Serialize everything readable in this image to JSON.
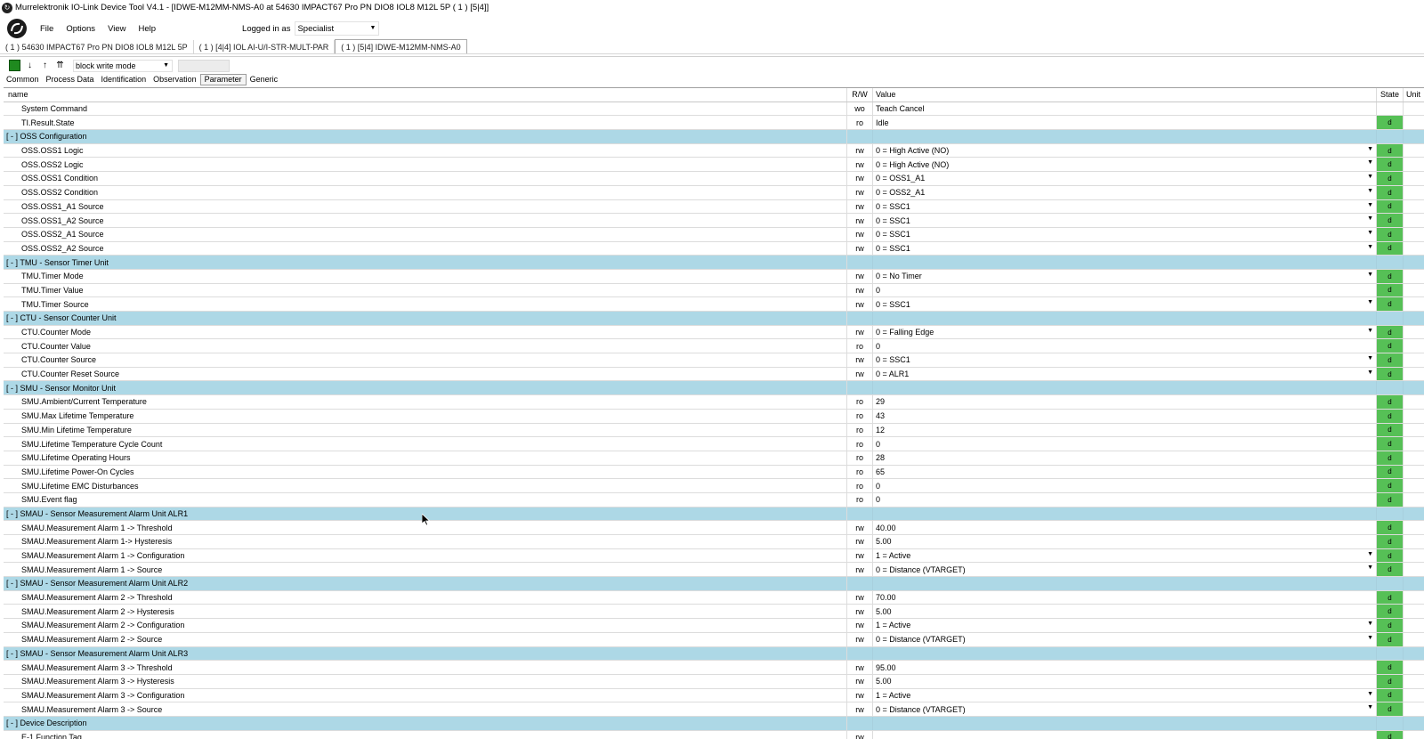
{
  "window": {
    "title": "Murrelektronik IO-Link Device Tool V4.1 - [IDWE-M12MM-NMS-A0 at 54630 IMPACT67 Pro PN DIO8 IOL8 M12L 5P ( 1 ) [5|4]]"
  },
  "menu": {
    "file": "File",
    "options": "Options",
    "view": "View",
    "help": "Help"
  },
  "login": {
    "label": "Logged in as",
    "role": "Specialist"
  },
  "device_tabs": [
    {
      "label": "( 1 ) 54630 IMPACT67 Pro PN DIO8 IOL8 M12L 5P"
    },
    {
      "label": "( 1 ) [4|4] IOL AI-U/I-STR-MULT-PAR"
    },
    {
      "label": "( 1 ) [5|4] IDWE-M12MM-NMS-A0"
    }
  ],
  "toolbar": {
    "mode": "block write mode"
  },
  "view_tabs": [
    {
      "label": "Common"
    },
    {
      "label": "Process Data"
    },
    {
      "label": "Identification"
    },
    {
      "label": "Observation"
    },
    {
      "label": "Parameter"
    },
    {
      "label": "Generic"
    }
  ],
  "columns": {
    "name": "name",
    "rw": "R/W",
    "value": "Value",
    "state": "State",
    "unit": "Unit"
  },
  "rows": [
    {
      "type": "item",
      "name": "System Command",
      "rw": "wo",
      "value": "Teach Cancel",
      "state": "",
      "dd": false
    },
    {
      "type": "item",
      "name": "TI.Result.State",
      "rw": "ro",
      "value": "Idle",
      "state": "d",
      "dd": false
    },
    {
      "type": "group",
      "name": "[ - ]  OSS Configuration"
    },
    {
      "type": "item",
      "name": "OSS.OSS1 Logic",
      "rw": "rw",
      "value": "0 = High Active (NO)",
      "state": "d",
      "dd": true
    },
    {
      "type": "item",
      "name": "OSS.OSS2 Logic",
      "rw": "rw",
      "value": "0 = High Active (NO)",
      "state": "d",
      "dd": true
    },
    {
      "type": "item",
      "name": "OSS.OSS1 Condition",
      "rw": "rw",
      "value": "0 = OSS1_A1",
      "state": "d",
      "dd": true
    },
    {
      "type": "item",
      "name": "OSS.OSS2 Condition",
      "rw": "rw",
      "value": "0 = OSS2_A1",
      "state": "d",
      "dd": true
    },
    {
      "type": "item",
      "name": "OSS.OSS1_A1 Source",
      "rw": "rw",
      "value": "0 = SSC1",
      "state": "d",
      "dd": true
    },
    {
      "type": "item",
      "name": "OSS.OSS1_A2 Source",
      "rw": "rw",
      "value": "0 = SSC1",
      "state": "d",
      "dd": true
    },
    {
      "type": "item",
      "name": "OSS.OSS2_A1 Source",
      "rw": "rw",
      "value": "0 = SSC1",
      "state": "d",
      "dd": true
    },
    {
      "type": "item",
      "name": "OSS.OSS2_A2 Source",
      "rw": "rw",
      "value": "0 = SSC1",
      "state": "d",
      "dd": true
    },
    {
      "type": "group",
      "name": "[ - ]  TMU - Sensor Timer Unit"
    },
    {
      "type": "item",
      "name": "TMU.Timer Mode",
      "rw": "rw",
      "value": "0 = No Timer",
      "state": "d",
      "dd": true
    },
    {
      "type": "item",
      "name": "TMU.Timer Value",
      "rw": "rw",
      "value": "0",
      "state": "d",
      "dd": false
    },
    {
      "type": "item",
      "name": "TMU.Timer Source",
      "rw": "rw",
      "value": "0 = SSC1",
      "state": "d",
      "dd": true
    },
    {
      "type": "group",
      "name": "[ - ]  CTU - Sensor Counter Unit"
    },
    {
      "type": "item",
      "name": "CTU.Counter Mode",
      "rw": "rw",
      "value": "0 = Falling Edge",
      "state": "d",
      "dd": true
    },
    {
      "type": "item",
      "name": "CTU.Counter Value",
      "rw": "ro",
      "value": "0",
      "state": "d",
      "dd": false
    },
    {
      "type": "item",
      "name": "CTU.Counter Source",
      "rw": "rw",
      "value": "0 = SSC1",
      "state": "d",
      "dd": true
    },
    {
      "type": "item",
      "name": "CTU.Counter Reset Source",
      "rw": "rw",
      "value": "0 = ALR1",
      "state": "d",
      "dd": true
    },
    {
      "type": "group",
      "name": "[ - ]  SMU - Sensor Monitor Unit"
    },
    {
      "type": "item",
      "name": "SMU.Ambient/Current Temperature",
      "rw": "ro",
      "value": "29",
      "state": "d",
      "dd": false
    },
    {
      "type": "item",
      "name": "SMU.Max Lifetime Temperature",
      "rw": "ro",
      "value": "43",
      "state": "d",
      "dd": false
    },
    {
      "type": "item",
      "name": "SMU.Min Lifetime Temperature",
      "rw": "ro",
      "value": "12",
      "state": "d",
      "dd": false
    },
    {
      "type": "item",
      "name": "SMU.Lifetime Temperature Cycle Count",
      "rw": "ro",
      "value": "0",
      "state": "d",
      "dd": false
    },
    {
      "type": "item",
      "name": "SMU.Lifetime Operating Hours",
      "rw": "ro",
      "value": "28",
      "state": "d",
      "dd": false
    },
    {
      "type": "item",
      "name": "SMU.Lifetime Power-On Cycles",
      "rw": "ro",
      "value": "65",
      "state": "d",
      "dd": false
    },
    {
      "type": "item",
      "name": "SMU.Lifetime EMC Disturbances",
      "rw": "ro",
      "value": "0",
      "state": "d",
      "dd": false
    },
    {
      "type": "item",
      "name": "SMU.Event flag",
      "rw": "ro",
      "value": "0",
      "state": "d",
      "dd": false
    },
    {
      "type": "group",
      "name": "[ - ]  SMAU - Sensor Measurement Alarm Unit ALR1"
    },
    {
      "type": "item",
      "name": "SMAU.Measurement Alarm 1 -> Threshold",
      "rw": "rw",
      "value": "40.00",
      "state": "d",
      "dd": false
    },
    {
      "type": "item",
      "name": "SMAU.Measurement Alarm 1->  Hysteresis",
      "rw": "rw",
      "value": "5.00",
      "state": "d",
      "dd": false
    },
    {
      "type": "item",
      "name": "SMAU.Measurement Alarm 1 -> Configuration",
      "rw": "rw",
      "value": "1 = Active",
      "state": "d",
      "dd": true
    },
    {
      "type": "item",
      "name": "SMAU.Measurement Alarm 1 -> Source",
      "rw": "rw",
      "value": "0 = Distance (VTARGET)",
      "state": "d",
      "dd": true
    },
    {
      "type": "group",
      "name": "[ - ]  SMAU - Sensor Measurement Alarm Unit ALR2"
    },
    {
      "type": "item",
      "name": "SMAU.Measurement Alarm 2 -> Threshold",
      "rw": "rw",
      "value": "70.00",
      "state": "d",
      "dd": false
    },
    {
      "type": "item",
      "name": "SMAU.Measurement Alarm 2 -> Hysteresis",
      "rw": "rw",
      "value": "5.00",
      "state": "d",
      "dd": false
    },
    {
      "type": "item",
      "name": "SMAU.Measurement Alarm 2 -> Configuration",
      "rw": "rw",
      "value": "1 = Active",
      "state": "d",
      "dd": true
    },
    {
      "type": "item",
      "name": "SMAU.Measurement Alarm 2 -> Source",
      "rw": "rw",
      "value": "0 = Distance (VTARGET)",
      "state": "d",
      "dd": true
    },
    {
      "type": "group",
      "name": "[ - ]  SMAU - Sensor Measurement Alarm Unit ALR3"
    },
    {
      "type": "item",
      "name": "SMAU.Measurement Alarm 3 -> Threshold",
      "rw": "rw",
      "value": "95.00",
      "state": "d",
      "dd": false
    },
    {
      "type": "item",
      "name": "SMAU.Measurement Alarm 3 -> Hysteresis",
      "rw": "rw",
      "value": "5.00",
      "state": "d",
      "dd": false
    },
    {
      "type": "item",
      "name": "SMAU.Measurement Alarm 3 -> Configuration",
      "rw": "rw",
      "value": "1 = Active",
      "state": "d",
      "dd": true
    },
    {
      "type": "item",
      "name": "SMAU.Measurement Alarm 3 -> Source",
      "rw": "rw",
      "value": "0 = Distance (VTARGET)",
      "state": "d",
      "dd": true
    },
    {
      "type": "group",
      "name": "[ - ]  Device Description"
    },
    {
      "type": "item",
      "name": "E-1 Function Tag",
      "rw": "rw",
      "value": "",
      "state": "d",
      "dd": false
    }
  ],
  "colors": {
    "group_bg": "#add8e6",
    "state_ok": "#56c056"
  }
}
